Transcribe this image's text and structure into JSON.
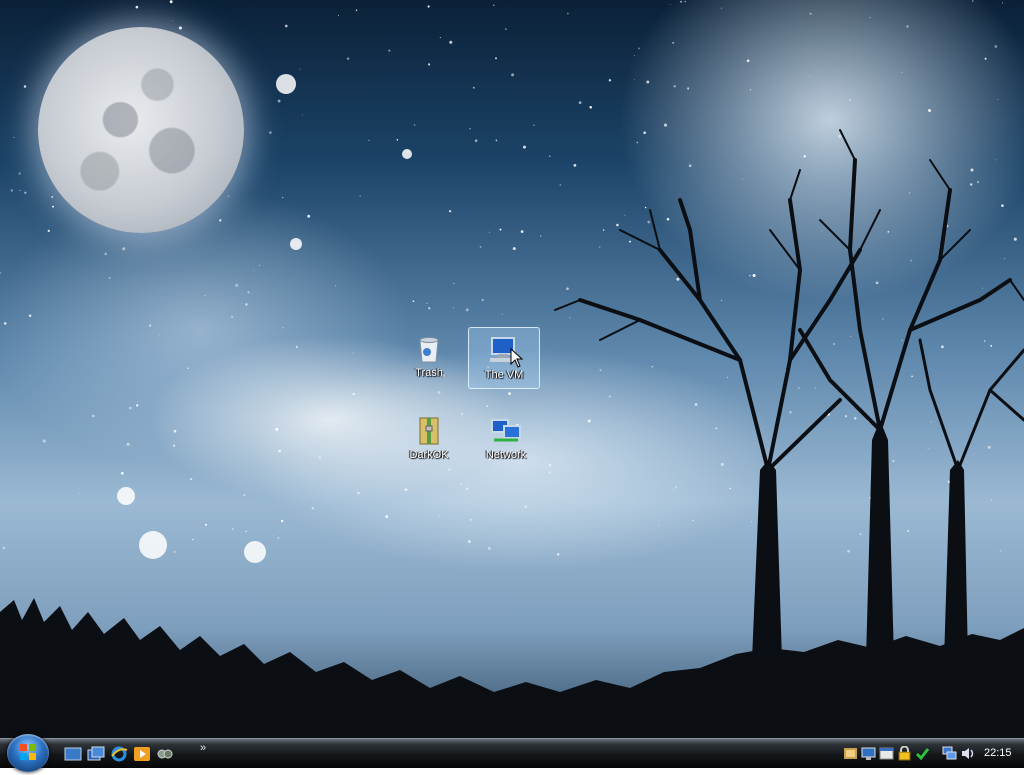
{
  "desktop": {
    "icons": [
      {
        "label": "Trash",
        "icon": "trash-icon"
      },
      {
        "label": "The VM",
        "icon": "computer-icon",
        "selected": true
      },
      {
        "label": "DarkOK",
        "icon": "folder-zipped-icon"
      },
      {
        "label": "Network",
        "icon": "network-icon"
      }
    ]
  },
  "taskbar": {
    "start_icon": "start-orb-icon",
    "quick_launch": [
      "show-desktop-icon",
      "window-switcher-icon",
      "internet-explorer-icon",
      "media-player-icon",
      "messenger-icon"
    ],
    "overflow_label": "»",
    "tray_icons": [
      "security-alert-icon",
      "display-icon",
      "window-icon",
      "lock-icon",
      "check-icon",
      "network-status-icon",
      "volume-icon"
    ],
    "clock": "22:15"
  },
  "colors": {
    "taskbar": "#14171a",
    "start_orb": "#2a6fc0",
    "selection": "#aad2f5"
  }
}
